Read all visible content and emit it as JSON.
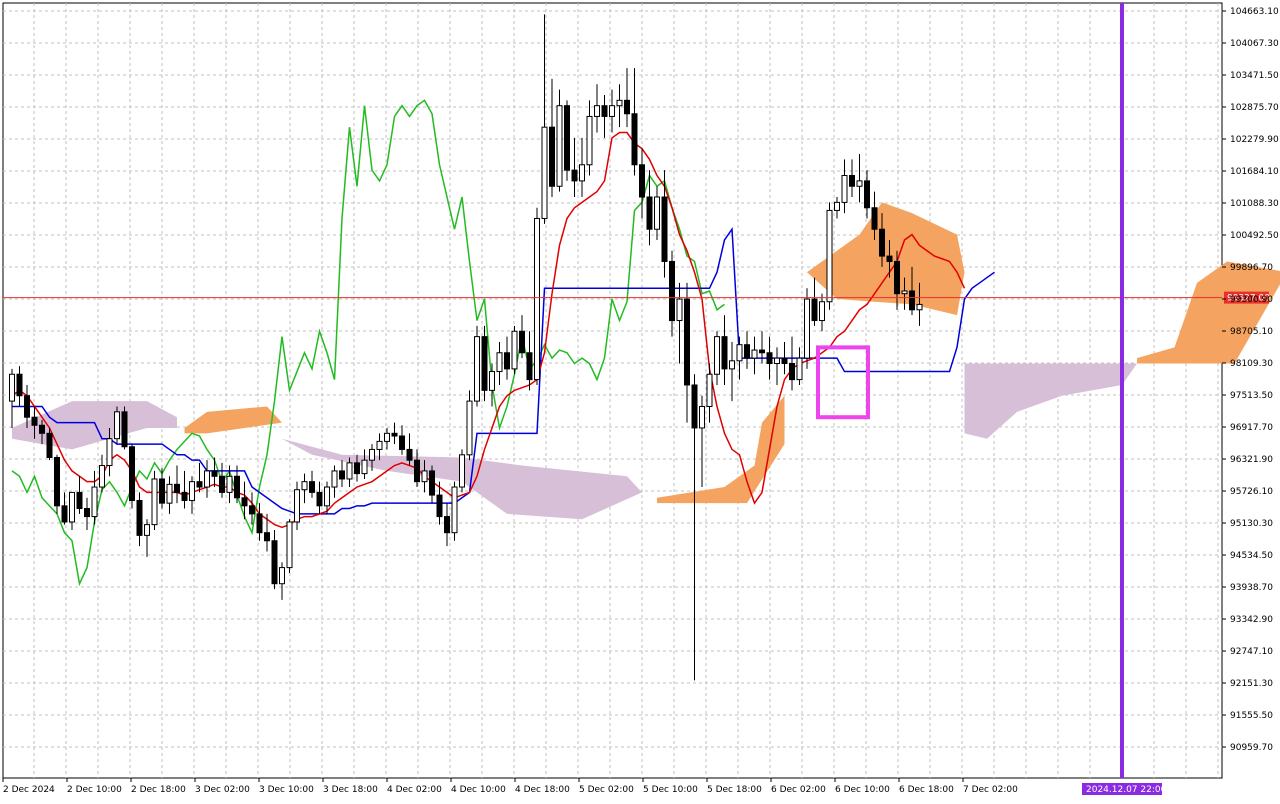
{
  "chart_data": {
    "type": "candlestick",
    "indicator": "Ichimoku",
    "y_axis": {
      "min": 90959.7,
      "max": 104663.1,
      "ticks": [
        "104663.10",
        "104067.30",
        "103471.50",
        "102875.70",
        "102279.90",
        "101684.10",
        "101088.30",
        "100492.50",
        "99896.70",
        "99300.90",
        "98705.10",
        "98109.30",
        "97513.50",
        "96917.70",
        "96321.90",
        "95726.10",
        "95130.30",
        "94534.50",
        "93938.70",
        "93342.90",
        "92747.10",
        "92151.30",
        "91555.50",
        "90959.70"
      ]
    },
    "x_axis": {
      "ticks": [
        "2 Dec 2024",
        "2 Dec 10:00",
        "2 Dec 18:00",
        "3 Dec 02:00",
        "3 Dec 10:00",
        "3 Dec 18:00",
        "4 Dec 02:00",
        "4 Dec 10:00",
        "4 Dec 18:00",
        "5 Dec 02:00",
        "5 Dec 10:00",
        "5 Dec 18:00",
        "6 Dec 02:00",
        "6 Dec 10:00",
        "6 Dec 18:00",
        "7 Dec 02:00"
      ]
    },
    "current_price": {
      "value": 99327.0,
      "label": "99327.00",
      "color": "#e8302a"
    },
    "vertical_marker": {
      "label": "2024.12.07 22:00",
      "color": "#8a2be2"
    },
    "colors": {
      "tenkan": "#e00000",
      "kijun": "#0000dd",
      "chikou": "#22bb22",
      "kumo_bull": "#f4a460",
      "kumo_bear": "#d8bfd8",
      "bull_candle": "#ffffff",
      "bear_candle": "#000000",
      "highlight_box": "#ee44ee",
      "grid": "#c0c0c0"
    },
    "candles": [
      [
        97400,
        98000,
        96900,
        97900
      ],
      [
        97900,
        98050,
        97300,
        97500
      ],
      [
        97500,
        97700,
        96900,
        97100
      ],
      [
        97100,
        97300,
        96700,
        96950
      ],
      [
        96950,
        97050,
        96600,
        96800
      ],
      [
        96800,
        96900,
        96300,
        96350
      ],
      [
        96350,
        96400,
        95300,
        95450
      ],
      [
        95450,
        95700,
        95100,
        95150
      ],
      [
        95150,
        95600,
        95000,
        95700
      ],
      [
        95700,
        96000,
        95300,
        95400
      ],
      [
        95400,
        95600,
        95000,
        95250
      ],
      [
        95250,
        96100,
        95100,
        95800
      ],
      [
        95800,
        96400,
        95700,
        96200
      ],
      [
        96200,
        96900,
        96000,
        96700
      ],
      [
        96700,
        97300,
        96600,
        97200
      ],
      [
        97200,
        97300,
        96500,
        96550
      ],
      [
        96550,
        96600,
        95400,
        95550
      ],
      [
        95550,
        95700,
        94700,
        94900
      ],
      [
        94900,
        95200,
        94500,
        95100
      ],
      [
        95100,
        96100,
        95000,
        95950
      ],
      [
        95950,
        96150,
        95400,
        95500
      ],
      [
        95500,
        96000,
        95300,
        95850
      ],
      [
        95850,
        96200,
        95500,
        95700
      ],
      [
        95700,
        96100,
        95400,
        95550
      ],
      [
        95550,
        96000,
        95300,
        95900
      ],
      [
        95900,
        96250,
        95700,
        95800
      ],
      [
        95800,
        96300,
        95600,
        96100
      ],
      [
        96100,
        96350,
        95800,
        96000
      ],
      [
        96000,
        96250,
        95600,
        95700
      ],
      [
        95700,
        96200,
        95500,
        96000
      ],
      [
        96000,
        96200,
        95500,
        95600
      ],
      [
        95600,
        95900,
        95200,
        95450
      ],
      [
        95450,
        95700,
        95100,
        95300
      ],
      [
        95300,
        95500,
        94800,
        94950
      ],
      [
        94950,
        95300,
        94600,
        94800
      ],
      [
        94800,
        95000,
        93900,
        94000
      ],
      [
        94000,
        94400,
        93700,
        94300
      ],
      [
        94300,
        95200,
        94200,
        95150
      ],
      [
        95150,
        95900,
        95000,
        95750
      ],
      [
        95750,
        96050,
        95500,
        95900
      ],
      [
        95900,
        96100,
        95600,
        95700
      ],
      [
        95700,
        95900,
        95300,
        95450
      ],
      [
        95450,
        95900,
        95300,
        95800
      ],
      [
        95800,
        96200,
        95600,
        96100
      ],
      [
        96100,
        96300,
        95800,
        95950
      ],
      [
        95950,
        96350,
        95800,
        96250
      ],
      [
        96250,
        96400,
        95900,
        96050
      ],
      [
        96050,
        96500,
        95950,
        96300
      ],
      [
        96300,
        96600,
        96100,
        96500
      ],
      [
        96500,
        96800,
        96300,
        96650
      ],
      [
        96650,
        96900,
        96500,
        96800
      ],
      [
        96800,
        97000,
        96600,
        96750
      ],
      [
        96750,
        96950,
        96400,
        96500
      ],
      [
        96500,
        96800,
        96200,
        96300
      ],
      [
        96300,
        96500,
        95800,
        95900
      ],
      [
        95900,
        96300,
        95700,
        96100
      ],
      [
        96100,
        96200,
        95500,
        95650
      ],
      [
        95650,
        95900,
        95100,
        95250
      ],
      [
        95250,
        95500,
        94700,
        94950
      ],
      [
        94950,
        95900,
        94800,
        95800
      ],
      [
        95800,
        96500,
        95700,
        96400
      ],
      [
        96400,
        97600,
        96300,
        97400
      ],
      [
        97400,
        98800,
        97300,
        98600
      ],
      [
        98600,
        98800,
        97400,
        97600
      ],
      [
        97600,
        98100,
        97300,
        97950
      ],
      [
        97950,
        98500,
        97700,
        98300
      ],
      [
        98300,
        98600,
        97800,
        98000
      ],
      [
        98000,
        98800,
        97900,
        98700
      ],
      [
        98700,
        99000,
        98200,
        98300
      ],
      [
        98300,
        98700,
        97600,
        97800
      ],
      [
        97800,
        101000,
        97700,
        100800
      ],
      [
        100800,
        104600,
        100700,
        102500
      ],
      [
        102500,
        103400,
        101200,
        101400
      ],
      [
        101400,
        103200,
        101300,
        102900
      ],
      [
        102900,
        103000,
        101500,
        101700
      ],
      [
        101700,
        102300,
        101200,
        101500
      ],
      [
        101500,
        102300,
        101200,
        101800
      ],
      [
        101800,
        103000,
        101600,
        102700
      ],
      [
        102700,
        103300,
        102400,
        102900
      ],
      [
        102900,
        103100,
        102300,
        102700
      ],
      [
        102700,
        103200,
        102400,
        102900
      ],
      [
        102900,
        103300,
        102500,
        103000
      ],
      [
        103000,
        103600,
        102500,
        102750
      ],
      [
        102750,
        103600,
        101600,
        101800
      ],
      [
        101800,
        102100,
        100800,
        101200
      ],
      [
        101200,
        101700,
        100300,
        100600
      ],
      [
        100600,
        101400,
        100400,
        101200
      ],
      [
        101200,
        101700,
        99700,
        100000
      ],
      [
        100000,
        100200,
        98600,
        98900
      ],
      [
        98900,
        99600,
        98100,
        99300
      ],
      [
        99300,
        99600,
        97000,
        97700
      ],
      [
        97700,
        97900,
        92200,
        96900
      ],
      [
        96900,
        97500,
        95800,
        97300
      ],
      [
        97300,
        98100,
        97000,
        97900
      ],
      [
        97900,
        98700,
        97700,
        98600
      ],
      [
        98600,
        99000,
        97700,
        98000
      ],
      [
        98000,
        98500,
        97400,
        98150
      ],
      [
        98150,
        98600,
        97800,
        98450
      ],
      [
        98450,
        98700,
        98000,
        98200
      ],
      [
        98200,
        98600,
        97900,
        98350
      ],
      [
        98350,
        98700,
        98100,
        98300
      ],
      [
        98300,
        98600,
        97800,
        98100
      ],
      [
        98100,
        98400,
        97700,
        98200
      ],
      [
        98200,
        98500,
        97900,
        98100
      ],
      [
        98100,
        98600,
        97600,
        97800
      ],
      [
        97800,
        98400,
        97700,
        98200
      ],
      [
        98200,
        99500,
        98000,
        99300
      ],
      [
        99300,
        99700,
        98800,
        98900
      ],
      [
        98900,
        99400,
        98700,
        99250
      ],
      [
        99250,
        101100,
        99100,
        100950
      ],
      [
        100950,
        101200,
        100800,
        101100
      ],
      [
        101100,
        101900,
        100900,
        101600
      ],
      [
        101600,
        101900,
        101200,
        101400
      ],
      [
        101400,
        102000,
        101100,
        101500
      ],
      [
        101500,
        101700,
        100800,
        101000
      ],
      [
        101000,
        101300,
        100400,
        100600
      ],
      [
        100600,
        100900,
        99900,
        100100
      ],
      [
        100100,
        100400,
        99700,
        100000
      ],
      [
        100000,
        100200,
        99100,
        99400
      ],
      [
        99400,
        99700,
        99100,
        99450
      ],
      [
        99450,
        99900,
        99000,
        99100
      ],
      [
        99100,
        99600,
        98800,
        99200
      ]
    ],
    "tenkan": [
      97500,
      97600,
      97500,
      97300,
      97100,
      96900,
      96600,
      96300,
      96100,
      96000,
      95900,
      95900,
      96000,
      96300,
      96400,
      96300,
      96100,
      95800,
      95700,
      95700,
      95700,
      95700,
      95700,
      95650,
      95700,
      95750,
      95800,
      95850,
      95800,
      95800,
      95700,
      95650,
      95500,
      95300,
      95200,
      95100,
      95050,
      95100,
      95200,
      95250,
      95250,
      95300,
      95350,
      95500,
      95600,
      95700,
      95800,
      95850,
      95900,
      96000,
      96100,
      96200,
      96250,
      96200,
      96150,
      96000,
      95900,
      95800,
      95700,
      95600,
      95650,
      95700,
      96000,
      96500,
      96900,
      97300,
      97500,
      97600,
      97650,
      97700,
      97800,
      98300,
      99400,
      100300,
      100800,
      101000,
      101100,
      101200,
      101300,
      101500,
      102300,
      102400,
      102400,
      102200,
      102100,
      101900,
      101600,
      101400,
      101000,
      100500,
      100200,
      99800,
      99300,
      98000,
      97300,
      96800,
      96500,
      96400,
      95900,
      95500,
      95700,
      96500,
      97300,
      97800,
      98000,
      98100,
      98150,
      98200,
      98300,
      98400,
      98600,
      98700,
      98900,
      99100,
      99200,
      99400,
      99600,
      99800,
      100000,
      100400,
      100500,
      100300,
      100200,
      100100,
      100050,
      100000,
      99800,
      99500
    ],
    "kijun": [
      97300,
      97300,
      97300,
      97300,
      97300,
      97100,
      97000,
      97000,
      97000,
      97000,
      97000,
      97000,
      96700,
      96700,
      96600,
      96600,
      96600,
      96600,
      96600,
      96600,
      96600,
      96500,
      96400,
      96400,
      96300,
      96300,
      96100,
      96100,
      96100,
      96100,
      96100,
      96100,
      95800,
      95700,
      95600,
      95500,
      95400,
      95350,
      95300,
      95300,
      95300,
      95300,
      95300,
      95300,
      95400,
      95400,
      95450,
      95450,
      95500,
      95500,
      95500,
      95500,
      95500,
      95500,
      95500,
      95500,
      95500,
      95500,
      95500,
      95500,
      95600,
      95700,
      96800,
      96800,
      96800,
      96800,
      96800,
      96800,
      96800,
      96800,
      96800,
      99500,
      99500,
      99500,
      99500,
      99500,
      99500,
      99500,
      99500,
      99500,
      99500,
      99500,
      99500,
      99500,
      99500,
      99500,
      99500,
      99500,
      99500,
      99500,
      99500,
      99500,
      99500,
      99500,
      99800,
      100400,
      100600,
      98200,
      98200,
      98200,
      98200,
      98200,
      98200,
      98200,
      98200,
      98200,
      98200,
      98200,
      98200,
      98200,
      98200,
      97950,
      97950,
      97950,
      97950,
      97950,
      97950,
      97950,
      97950,
      97950,
      97950,
      97950,
      97950,
      97950,
      97950,
      97950,
      98400,
      99300,
      99500,
      99600,
      99700,
      99800
    ]
  }
}
